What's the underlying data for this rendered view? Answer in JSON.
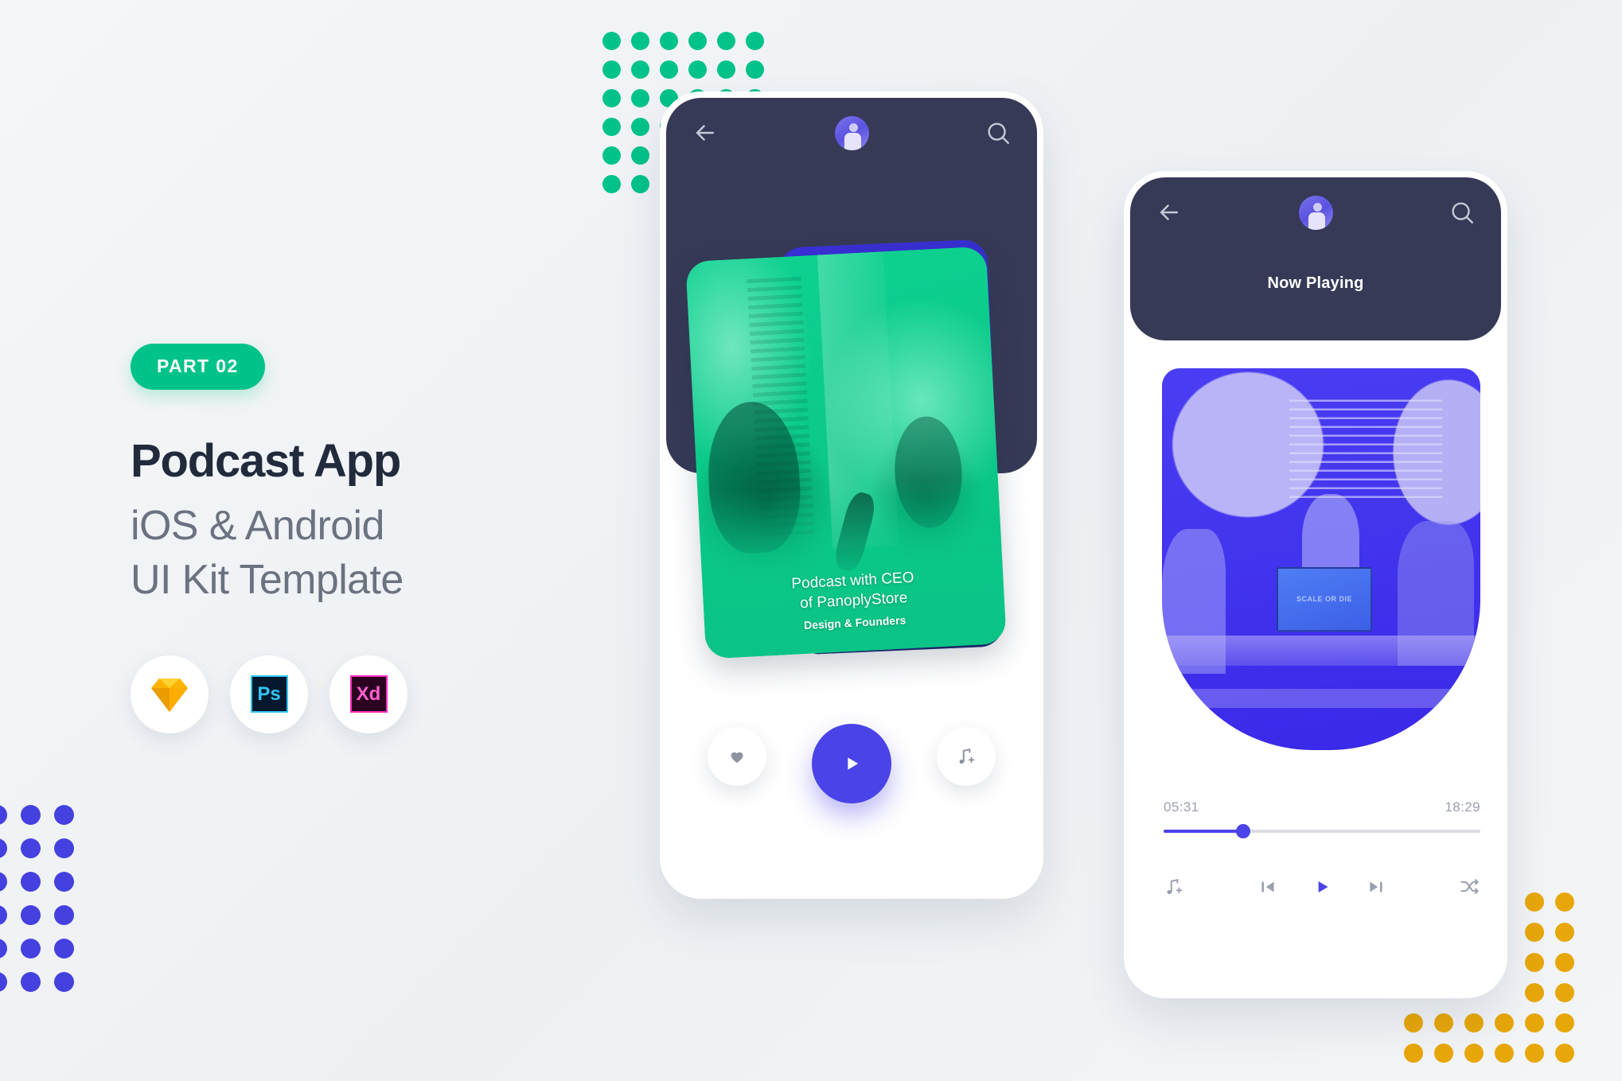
{
  "meta": {
    "canvas_bg": "#f2f5f7"
  },
  "promo": {
    "badge": "PART 02",
    "badge_color": "#00c389",
    "headline": "Podcast App",
    "subline_1": "iOS & Android",
    "subline_2": "UI Kit Template",
    "headline_color": "#222b3c",
    "subline_color": "#6b7280",
    "tools": [
      {
        "name": "sketch-icon",
        "label": "",
        "color": "#f7a623"
      },
      {
        "name": "photoshop-icon",
        "label": "Ps",
        "color": "#31c5f4"
      },
      {
        "name": "adobe-xd-icon",
        "label": "Xd",
        "color": "#ff61d2"
      }
    ]
  },
  "decor": {
    "green_dots": {
      "color": "#00c389",
      "cols": 6,
      "rows": 6
    },
    "blue_dots": {
      "color": "#4540e0",
      "cols": 3,
      "rows": 6
    },
    "yellow_dots": {
      "color": "#e8a709",
      "cols": 6,
      "rows": 6
    }
  },
  "phone1": {
    "nav": {
      "back": "back-arrow-icon",
      "avatar": "user-avatar",
      "search": "search-icon"
    },
    "card": {
      "title_line_1": "Podcast with CEO",
      "title_line_2": "of PanoplyStore",
      "subtitle": "Design & Founders",
      "accent": "#0ac487"
    },
    "controls": {
      "favorite": "heart-icon",
      "play": "play-icon",
      "add_to_playlist": "music-note-plus-icon",
      "play_color": "#4a43e8"
    }
  },
  "phone2": {
    "nav": {
      "back": "back-arrow-icon",
      "avatar": "user-avatar",
      "search": "search-icon"
    },
    "title": "Now Playing",
    "art": {
      "screen_text": "SCALE OR DIE",
      "tint": "#4334ee"
    },
    "progress": {
      "elapsed": "05:31",
      "remaining": "18:29",
      "percent": 25,
      "fill_color": "#4a43e8",
      "track_color": "#d9dce3"
    },
    "controls": {
      "add_to_playlist": "music-note-plus-icon",
      "previous": "skip-previous-icon",
      "play": "play-icon",
      "next": "skip-next-icon",
      "shuffle": "shuffle-icon",
      "play_color": "#4a43e8",
      "idle_color": "#9aa0ae"
    }
  }
}
